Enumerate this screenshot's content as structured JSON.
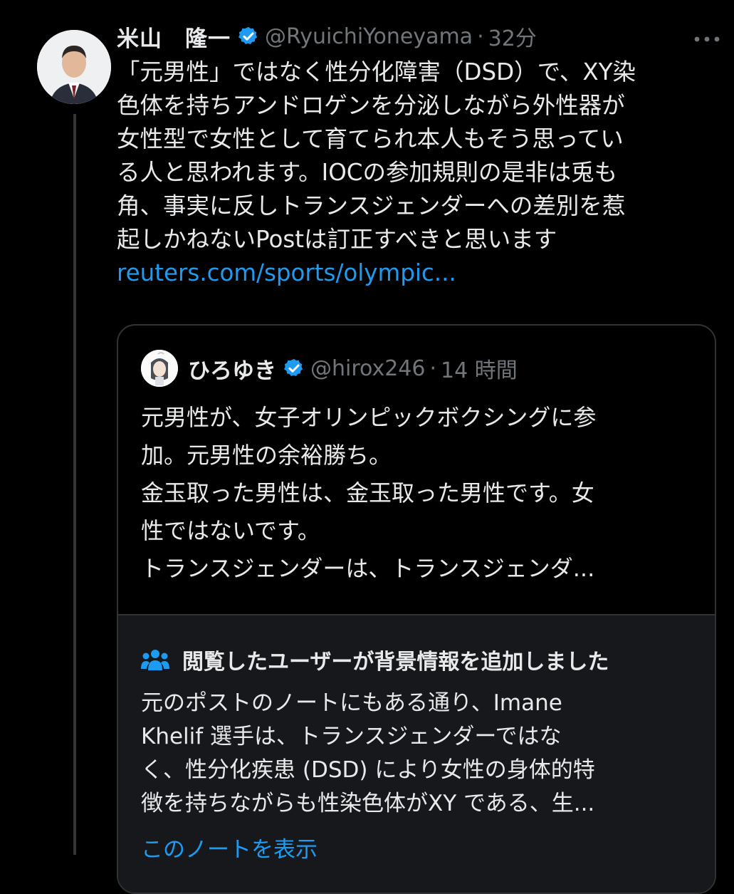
{
  "post": {
    "display_name": "米山　隆一",
    "handle": "@RyuichiYoneyama",
    "separator": "·",
    "time": "32分",
    "more_icon": "more-dots-icon",
    "text": "「元男性」ではなく性分化障害（DSD）で、XY染\n色体を持ちアンドロゲンを分泌しながら外性器が\n女性型で女性として育てられ本人もそう思ってい\nる人と思われます。IOCの参加規則の是非は兎も\n角、事実に反しトランスジェンダーへの差別を惹\n起しかねないPostは訂正すべきと思います",
    "link": "reuters.com/sports/olympic..."
  },
  "quote": {
    "display_name": "ひろゆき",
    "handle": "@hirox246",
    "separator": "·",
    "time": "14 時間",
    "text": "元男性が、女子オリンピックボクシングに参\n加。元男性の余裕勝ち。\n金玉取った男性は、金玉取った男性です。女\n性ではないです。\nトランスジェンダーは、トランスジェンダ..."
  },
  "note": {
    "icon": "people-icon",
    "title": "閲覧したユーザーが背景情報を追加しました",
    "text": "元のポストのノートにもある通り、Imane\nKhelif 選手は、トランスジェンダーではな\nく、性分化疾患 (DSD) により女性の身体的特\n徴を持ちながらも性染色体がXY である、生...",
    "link": "このノートを表示"
  },
  "colors": {
    "background": "#000000",
    "text": "#e7e9ea",
    "secondary": "#71767b",
    "accent": "#1d9bf0",
    "note_bg": "#16181c"
  }
}
